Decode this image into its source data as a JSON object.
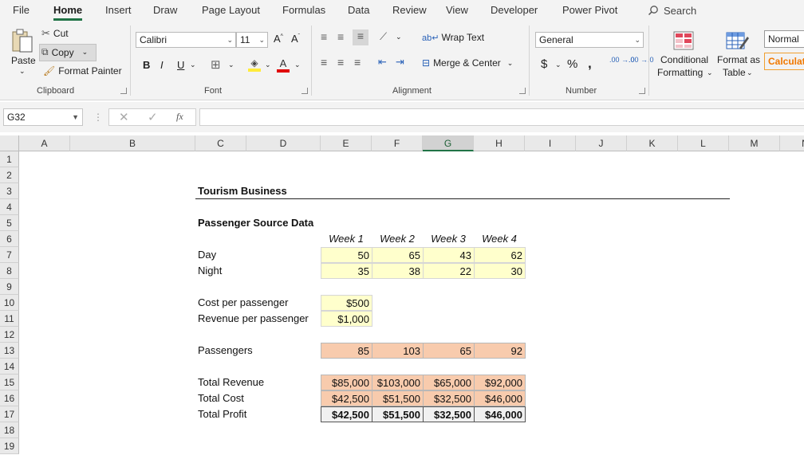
{
  "menu": {
    "tabs": [
      "File",
      "Home",
      "Insert",
      "Draw",
      "Page Layout",
      "Formulas",
      "Data",
      "Review",
      "View",
      "Developer",
      "Power Pivot"
    ],
    "search_label": "Search"
  },
  "ribbon": {
    "clipboard": {
      "paste": "Paste",
      "cut": "Cut",
      "copy": "Copy",
      "format_painter": "Format Painter",
      "label": "Clipboard"
    },
    "font": {
      "name": "Calibri",
      "size": "11",
      "bold": "B",
      "italic": "I",
      "underline": "U",
      "label": "Font"
    },
    "alignment": {
      "wrap_text": "Wrap Text",
      "merge_center": "Merge & Center",
      "label": "Alignment"
    },
    "number": {
      "format": "General",
      "currency": "$",
      "percent": "%",
      "comma": ",",
      "inc_decimal": ".00 →.0",
      "dec_decimal": ".00 →.0",
      "label": "Number"
    },
    "styles": {
      "conditional_1": "Conditional",
      "conditional_2": "Formatting",
      "format_table_1": "Format as",
      "format_table_2": "Table",
      "normal": "Normal",
      "calculation": "Calculati"
    }
  },
  "formula_bar": {
    "name_box": "G32",
    "fx": "fx",
    "formula": ""
  },
  "grid": {
    "columns": [
      "A",
      "B",
      "C",
      "D",
      "E",
      "F",
      "G",
      "H",
      "I",
      "J",
      "K",
      "L",
      "M",
      "N"
    ],
    "rows": [
      "1",
      "2",
      "3",
      "4",
      "5",
      "6",
      "7",
      "8",
      "9",
      "10",
      "11",
      "12",
      "13",
      "14",
      "15",
      "16",
      "17",
      "18",
      "19"
    ],
    "selected_column": "G"
  },
  "sheet": {
    "title": "Tourism Business",
    "section": "Passenger Source Data",
    "weeks": [
      "Week 1",
      "Week 2",
      "Week 3",
      "Week 4"
    ],
    "day_label": "Day",
    "day": [
      "50",
      "65",
      "43",
      "62"
    ],
    "night_label": "Night",
    "night": [
      "35",
      "38",
      "22",
      "30"
    ],
    "cost_label": "Cost per passenger",
    "cost": "$500",
    "revenue_label": "Revenue per passenger",
    "revenue": "$1,000",
    "passengers_label": "Passengers",
    "passengers": [
      "85",
      "103",
      "65",
      "92"
    ],
    "total_revenue_label": "Total Revenue",
    "total_revenue": [
      "$85,000",
      "$103,000",
      "$65,000",
      "$92,000"
    ],
    "total_cost_label": "Total Cost",
    "total_cost": [
      "$42,500",
      "$51,500",
      "$32,500",
      "$46,000"
    ],
    "total_profit_label": "Total Profit",
    "total_profit": [
      "$42,500",
      "$51,500",
      "$32,500",
      "$46,000"
    ]
  }
}
